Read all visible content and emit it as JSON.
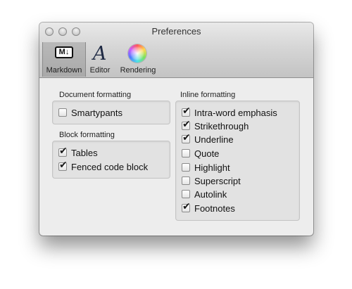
{
  "window": {
    "title": "Preferences"
  },
  "toolbar": {
    "markdown_label": "Markdown",
    "editor_label": "Editor",
    "rendering_label": "Rendering",
    "markdown_icon_text": "M↓",
    "editor_icon_text": "A"
  },
  "document_formatting": {
    "label": "Document formatting",
    "options": [
      {
        "label": "Smartypants",
        "checked": false
      }
    ]
  },
  "block_formatting": {
    "label": "Block formatting",
    "options": [
      {
        "label": "Tables",
        "checked": true
      },
      {
        "label": "Fenced code block",
        "checked": true
      }
    ]
  },
  "inline_formatting": {
    "label": "Inline formatting",
    "options": [
      {
        "label": "Intra-word emphasis",
        "checked": true
      },
      {
        "label": "Strikethrough",
        "checked": true
      },
      {
        "label": "Underline",
        "checked": true
      },
      {
        "label": "Quote",
        "checked": false
      },
      {
        "label": "Highlight",
        "checked": false
      },
      {
        "label": "Superscript",
        "checked": false
      },
      {
        "label": "Autolink",
        "checked": false
      },
      {
        "label": "Footnotes",
        "checked": true
      }
    ]
  }
}
